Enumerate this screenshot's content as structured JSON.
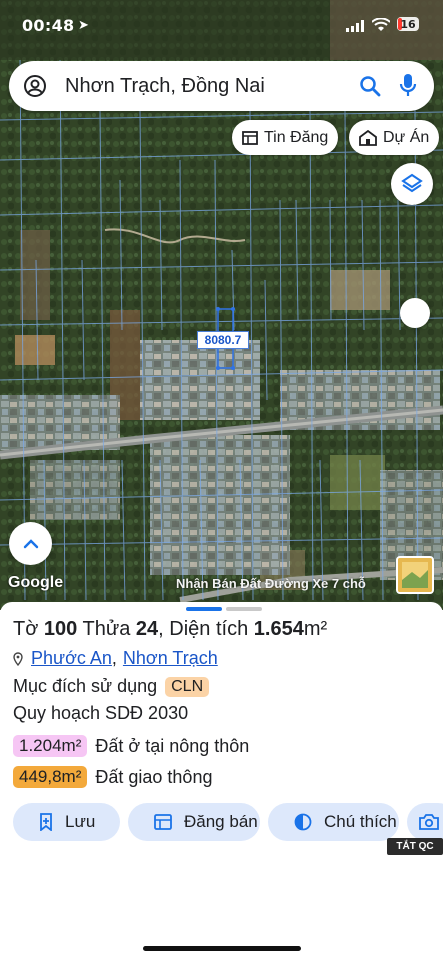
{
  "status_bar": {
    "time": "00:48",
    "battery": "16"
  },
  "search": {
    "query": "Nhơn Trạch, Đồng Nai"
  },
  "map_chips": [
    {
      "label": "Tin Đăng"
    },
    {
      "label": "Dự Án"
    }
  ],
  "map": {
    "measurement_label": "8080.7",
    "attribution": "Google",
    "ad_banner": "Nhận Bán Đất Đường Xe 7 chỗ"
  },
  "parcel": {
    "to_label": "Tờ",
    "to_value": "100",
    "thua_label": "Thửa",
    "thua_value": "24",
    "dientich_label": "Diện tích",
    "dientich_value": "1.654",
    "dientich_unit": "m²",
    "address": {
      "ward": "Phước An",
      "separator": ",",
      "district": "Nhơn Trạch"
    },
    "purpose_label": "Mục đích sử dụng",
    "purpose_code": "CLN",
    "plan_label": "Quy hoạch SDĐ 2030",
    "zones": [
      {
        "area": "1.204m²",
        "type": "Đất ở tại nông thôn",
        "color": "#f6c6f4"
      },
      {
        "area": "449,8m²",
        "type": "Đất giao thông",
        "color": "#f3a93b"
      }
    ]
  },
  "actions": [
    {
      "label": "Lưu"
    },
    {
      "label": "Đăng bán"
    },
    {
      "label": "Chú thích"
    }
  ],
  "ad_close_label": "TẮT QC",
  "colors": {
    "accent": "#1a73e8",
    "link": "#1a56c8",
    "action_bg": "#dde8fb",
    "parcel_line": "#7aa8e8"
  }
}
